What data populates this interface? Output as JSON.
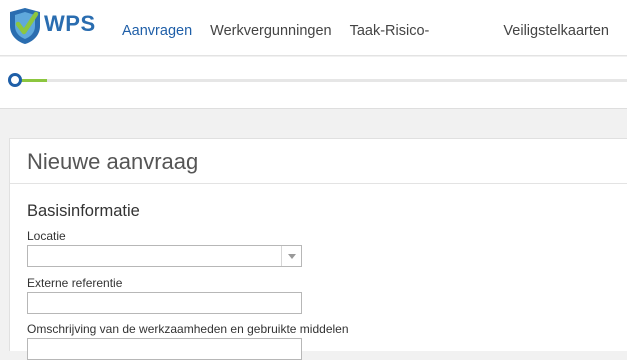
{
  "header": {
    "logo_text": "WPS",
    "nav": [
      {
        "label": "Aanvragen",
        "active": true
      },
      {
        "label": "Werkvergunningen"
      },
      {
        "label": "Taak-Risico-Analyses"
      },
      {
        "label": "Veiligstelkaarten"
      }
    ]
  },
  "progress": {
    "fraction": 0.05
  },
  "form": {
    "title": "Nieuwe aanvraag",
    "section": "Basisinformatie",
    "fields": [
      {
        "label": "Locatie",
        "value": "",
        "type": "select"
      },
      {
        "label": "Externe referentie",
        "value": "",
        "type": "text"
      },
      {
        "label": "Omschrijving van de werkzaamheden en gebruikte middelen",
        "value": "",
        "type": "text"
      }
    ]
  },
  "colors": {
    "accent": "#1f5fa8",
    "progress": "#8cc63f",
    "logo_green": "#8cc63f",
    "logo_blue": "#2a6db0"
  },
  "icons": {
    "logo": "wps-shield-logo",
    "dropdown": "chevron-down-icon"
  }
}
